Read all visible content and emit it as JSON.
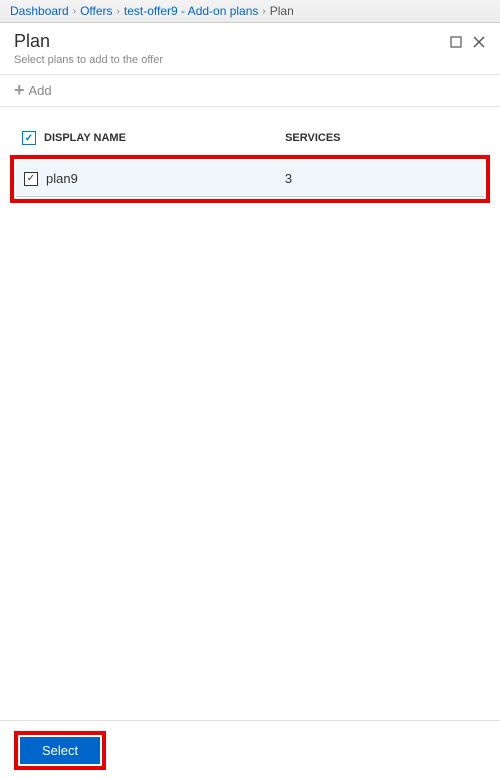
{
  "breadcrumb": {
    "items": [
      {
        "label": "Dashboard"
      },
      {
        "label": "Offers"
      },
      {
        "label": "test-offer9 - Add-on plans"
      }
    ],
    "current": "Plan"
  },
  "header": {
    "title": "Plan",
    "subtitle": "Select plans to add to the offer"
  },
  "toolbar": {
    "add_label": "Add"
  },
  "table": {
    "headers": {
      "display_name": "DISPLAY NAME",
      "services": "SERVICES"
    },
    "rows": [
      {
        "name": "plan9",
        "services": "3"
      }
    ]
  },
  "footer": {
    "select_label": "Select"
  }
}
